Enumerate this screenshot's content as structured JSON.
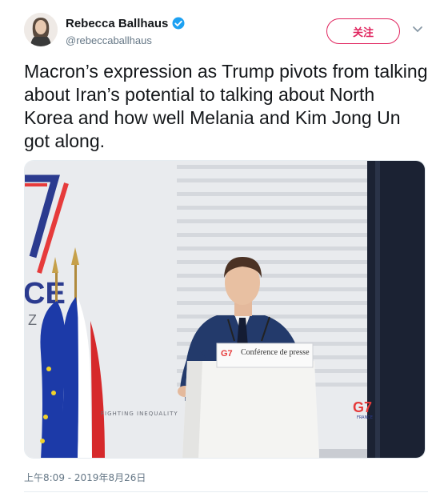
{
  "author": {
    "name": "Rebecca Ballhaus",
    "handle": "@rebeccaballhaus",
    "verified": true,
    "avatar_icon": "user-avatar"
  },
  "follow_button": {
    "label": "关注"
  },
  "menu": {
    "icon": "chevron-down-icon"
  },
  "tweet": {
    "text": "Macron’s expression as Trump pivots from talking about Iran’s potential to talking about North Korea and how well Melania and Kim Jong Un got along.",
    "timestamp": "上午8:09 - 2019年8月26日"
  },
  "media": {
    "podium_sign_title": "Conférence de presse",
    "podium_logo": "G7",
    "backdrop_text": "FIGHTING INEQUALITY",
    "backdrop_partial_letters": "CE",
    "backdrop_partial_letter2": "Z",
    "right_logo": "G7",
    "right_logo_sub": "FRANCE"
  },
  "colors": {
    "follow_accent": "#e0245e",
    "verified_blue": "#1da1f2",
    "secondary_text": "#657786"
  }
}
